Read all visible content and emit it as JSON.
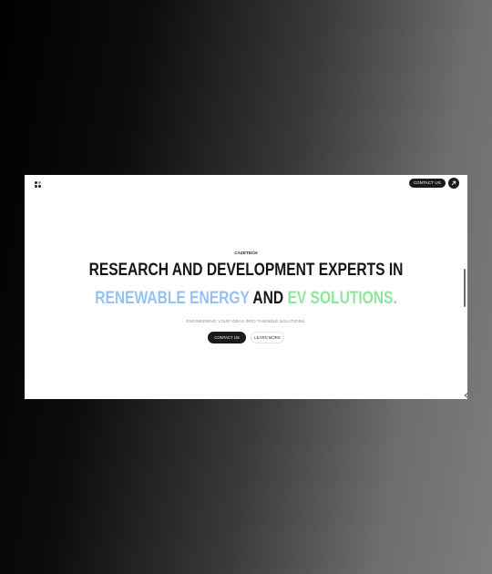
{
  "header": {
    "contact_label": "CONTACT US"
  },
  "hero": {
    "brand": "CAZETECH",
    "headline_line1": "RESEARCH AND DEVELOPMENT EXPERTS IN",
    "headline_blue": "RENEWABLE ENERGY",
    "headline_and": "AND",
    "headline_green": "EV SOLUTIONS.",
    "subtitle": "ENGINEERING YOUR IDEAS INTO TANGIBLE SOLUTIONS.",
    "primary_button": "CONTACT US",
    "secondary_button": "LEARN MORE"
  },
  "icons": {
    "logo": "logo-dots-icon",
    "arrow": "arrow-up-right-icon",
    "corner": "chevron-left-icon"
  },
  "colors": {
    "accent_blue": "#96c2f2",
    "accent_green": "#8ee69d",
    "dark": "#1a1a1a"
  }
}
